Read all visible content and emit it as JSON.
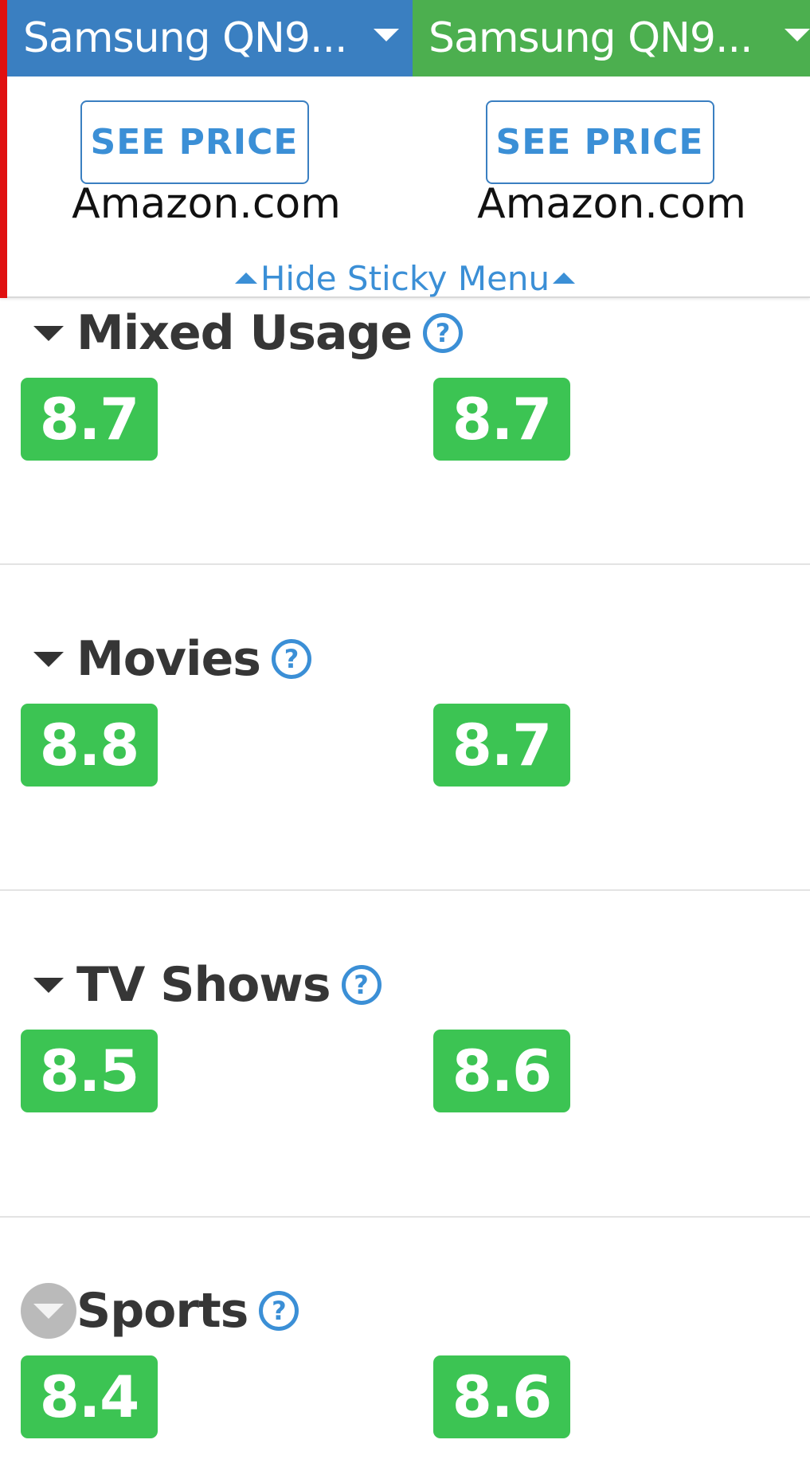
{
  "products": [
    {
      "name": "Samsung QN9...",
      "price_button": "SEE PRICE",
      "retailer": "Amazon.com"
    },
    {
      "name": "Samsung QN9...",
      "price_button": "SEE PRICE",
      "retailer": "Amazon.com"
    }
  ],
  "hide_sticky_label": "Hide Sticky Menu",
  "sections": [
    {
      "label": "Mixed Usage",
      "help": "?",
      "scores": [
        "8.7",
        "8.7"
      ]
    },
    {
      "label": "Movies",
      "help": "?",
      "scores": [
        "8.8",
        "8.7"
      ]
    },
    {
      "label": "TV Shows",
      "help": "?",
      "scores": [
        "8.5",
        "8.6"
      ]
    },
    {
      "label": "Sports",
      "help": "?",
      "scores": [
        "8.4",
        "8.6"
      ]
    }
  ],
  "colors": {
    "left_product": "#3a7fc1",
    "right_product": "#4caf4f",
    "score_badge": "#3cc453",
    "link": "#3b8fd6",
    "accent_bar": "#e01010"
  }
}
